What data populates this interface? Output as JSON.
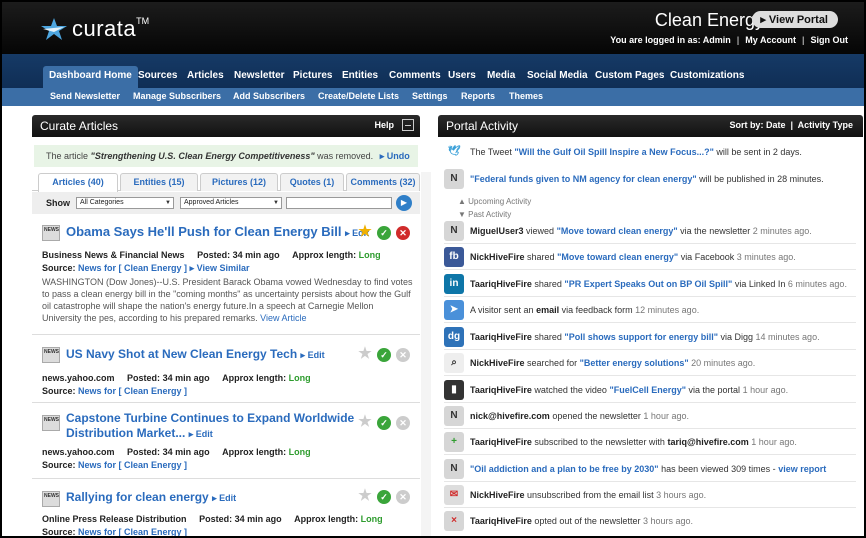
{
  "header": {
    "logo": "curata",
    "logo_tm": "TM",
    "portal_title": "Clean Energy",
    "view_portal": "View Portal",
    "logged_in": "You are logged in as: Admin",
    "my_account": "My Account",
    "sign_out": "Sign Out"
  },
  "nav": {
    "items": [
      "Dashboard Home",
      "Sources",
      "Articles",
      "Newsletter",
      "Pictures",
      "Entities",
      "Comments",
      "Users",
      "Media",
      "Social Media",
      "Custom Pages",
      "Customizations"
    ]
  },
  "subnav": {
    "items": [
      "Send Newsletter",
      "Manage Subscribers",
      "Add Subscribers",
      "Create/Delete Lists",
      "Settings",
      "Reports",
      "Themes"
    ]
  },
  "curate": {
    "title": "Curate Articles",
    "help": "Help",
    "notice_prefix": "The article",
    "notice_title": "\"Strengthening U.S. Clean Energy Competitiveness\"",
    "notice_suffix": "was removed.",
    "undo": "Undo",
    "tabs": [
      "Articles (40)",
      "Entities (15)",
      "Pictures (12)",
      "Quotes (1)",
      "Comments (32)"
    ],
    "show_label": "Show",
    "filter1": "All Categories",
    "filter2": "Approved Articles",
    "news_label": "NEWS",
    "articles": [
      {
        "title": "Obama Says He'll Push for Clean Energy Bill",
        "edit": "Edit",
        "source": "Business News & Financial News",
        "posted_label": "Posted:",
        "posted": "34 min ago",
        "length_label": "Approx length:",
        "length": "Long",
        "source_label": "Source:",
        "source_link": "News for [ Clean Energy ]",
        "view_similar": "View Similar",
        "excerpt": "WASHINGTON (Dow Jones)--U.S. President Barack Obama vowed Wednesday to find votes to pass a clean energy bill in the \"coming months\" as uncertainty persists about how the Gulf oil catastrophe will shape the nation's energy future.In a speech at Carnegie Mellon University the pes, according to his prepared remarks.",
        "view_article": "View Article"
      },
      {
        "title": "US Navy Shot at New Clean Energy Tech",
        "edit": "Edit",
        "source": "news.yahoo.com",
        "posted_label": "Posted:",
        "posted": "34 min ago",
        "length_label": "Approx length:",
        "length": "Long",
        "source_label": "Source:",
        "source_link": "News for [ Clean Energy ]"
      },
      {
        "title": "Capstone Turbine Continues to Expand Worldwide",
        "title2": "Distribution Market...",
        "edit": "Edit",
        "source": "news.yahoo.com",
        "posted_label": "Posted:",
        "posted": "34 min ago",
        "length_label": "Approx length:",
        "length": "Long",
        "source_label": "Source:",
        "source_link": "News for [ Clean Energy ]"
      },
      {
        "title": "Rallying for clean energy",
        "edit": "Edit",
        "source": "Online Press Release Distribution",
        "posted_label": "Posted:",
        "posted": "34 min ago",
        "length_label": "Approx length:",
        "length": "Long",
        "source_label": "Source:",
        "source_link": "News for [ Clean Energy ]"
      }
    ]
  },
  "activity": {
    "title": "Portal Activity",
    "sort_by": "Sort by: Date",
    "activity_type": "Activity Type",
    "upcoming": "Upcoming Activity",
    "past": "Past Activity",
    "items": [
      {
        "icon": "twitter-icon",
        "pre": "The Tweet",
        "link": "\"Will the Gulf Oil Spill Inspire a New Focus...?\"",
        "post": "will be sent in 2 days.",
        "time": ""
      },
      {
        "icon": "news-icon",
        "pre": "",
        "link": "\"Federal funds given to NM agency for clean energy\"",
        "post": "will be published in 28 minutes.",
        "time": ""
      },
      {
        "icon": "news-icon",
        "user": "MiguelUser3",
        "pre": "viewed",
        "link": "\"Move toward clean energy\"",
        "post": "via the newsletter",
        "time": "2 minutes ago."
      },
      {
        "icon": "facebook-icon",
        "user": "NickHiveFire",
        "pre": "shared",
        "link": "\"Move toward clean energy\"",
        "post": "via Facebook",
        "time": "3 minutes ago."
      },
      {
        "icon": "linkedin-icon",
        "user": "TaariqHiveFire",
        "pre": "shared",
        "link": "\"PR Expert Speaks Out on BP Oil Spill\"",
        "post": "via Linked In",
        "time": "6 minutes ago."
      },
      {
        "icon": "email-icon",
        "pre": "A visitor sent an",
        "bold": "email",
        "post": "via feedback form",
        "time": "12 minutes ago."
      },
      {
        "icon": "digg-icon",
        "user": "TaariqHiveFire",
        "pre": "shared",
        "link": "\"Poll shows support for energy bill\"",
        "post": "via Digg",
        "time": "14 minutes ago."
      },
      {
        "icon": "search-icon",
        "user": "NickHiveFire",
        "pre": "searched for",
        "link": "\"Better energy solutions\"",
        "post": "",
        "time": "20 minutes ago."
      },
      {
        "icon": "video-icon",
        "user": "TaariqHiveFire",
        "pre": "watched the video",
        "link": "\"FuelCell Energy\"",
        "post": "via the portal",
        "time": "1 hour ago."
      },
      {
        "icon": "news-icon",
        "user": "nick@hivefire.com",
        "pre": "opened the newsletter",
        "link": "",
        "post": "",
        "time": "1 hour ago."
      },
      {
        "icon": "news-add-icon",
        "user": "TaariqHiveFire",
        "pre": "subscribed to the newsletter with",
        "bold": "tariq@hivefire.com",
        "post": "",
        "time": "1 hour ago."
      },
      {
        "icon": "news-icon",
        "pre": "",
        "link": "\"Oil addiction and a plan to be free by 2030\"",
        "post": "has been viewed 309 times -",
        "link2": "view report",
        "time": ""
      },
      {
        "icon": "unsubscribe-icon",
        "user": "NickHiveFire",
        "pre": "unsubscribed from the email list",
        "post": "",
        "time": "3 hours ago."
      },
      {
        "icon": "news-remove-icon",
        "user": "TaariqHiveFire",
        "pre": "opted out of the newsletter",
        "post": "",
        "time": "3 hours ago."
      }
    ]
  }
}
